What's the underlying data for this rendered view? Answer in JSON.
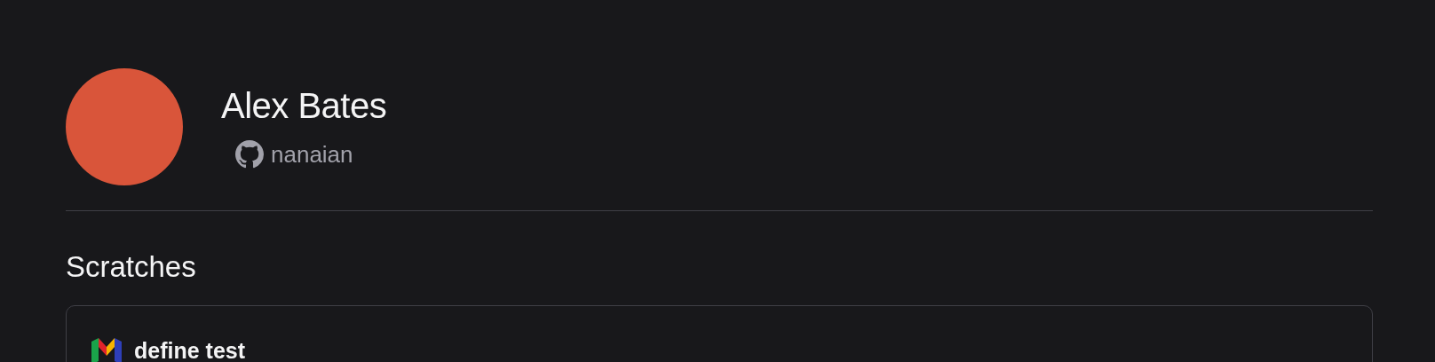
{
  "profile": {
    "name": "Alex Bates",
    "github_username": "nanaian"
  },
  "section_title": "Scratches",
  "scratches": [
    {
      "title": "define test"
    }
  ]
}
